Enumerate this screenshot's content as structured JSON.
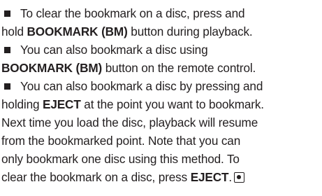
{
  "paragraphs": [
    {
      "line1": "To clear the bookmark on a disc, press and",
      "line2_pre": "hold ",
      "line2_bold": "BOOKMARK (BM)",
      "line2_post": " button during playback."
    },
    {
      "line1": "You can also bookmark a disc using",
      "line2_bold": "BOOKMARK (BM)",
      "line2_post": " button on the remote control."
    },
    {
      "line1": "You can also bookmark a disc by pressing and",
      "line2_pre": "holding ",
      "line2_bold": "EJECT",
      "line2_post": " at the point you want to bookmark.",
      "line3": "Next time you load the disc, playback will resume",
      "line4": "from the bookmarked point. Note that you can",
      "line5": "only bookmark one disc using this method. To",
      "line6_pre": "clear the bookmark on a disc, press ",
      "line6_bold": "EJECT",
      "line6_post": "."
    }
  ],
  "icons": {
    "bullet": "square-bullet-icon",
    "end_mark": "end-of-section-icon"
  }
}
